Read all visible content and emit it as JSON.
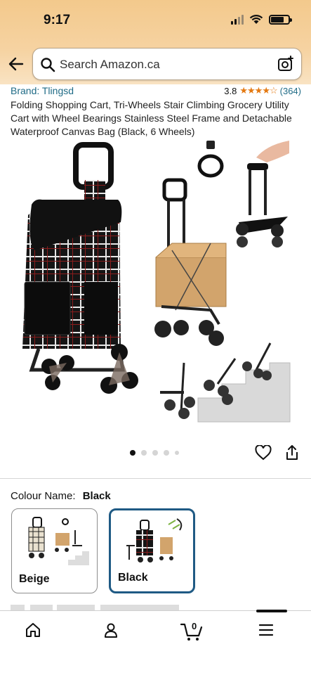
{
  "status_bar": {
    "time": "9:17"
  },
  "search": {
    "placeholder": "Search Amazon.ca"
  },
  "product": {
    "brand": "Brand: Tlingsd",
    "rating_value": "3.8",
    "rating_stars": "★★★★☆",
    "rating_count": "(364)",
    "title": "Folding Shopping Cart, Tri-Wheels Stair Climbing Grocery Utility Cart with Wheel Bearings Stainless Steel Frame and Detachable Waterproof Canvas Bag (Black, 6 Wheels)"
  },
  "gallery": {
    "image_count": 5,
    "active_index": 0
  },
  "colour": {
    "label": "Colour Name:",
    "selected": "Black",
    "options": [
      {
        "name": "Beige",
        "selected": false
      },
      {
        "name": "Black",
        "selected": true
      }
    ]
  },
  "cart": {
    "count": "0"
  },
  "icons": {
    "back": "back-arrow-icon",
    "search": "search-icon",
    "camera": "camera-search-icon",
    "heart": "heart-icon",
    "share": "share-icon",
    "home": "home-icon",
    "account": "account-icon",
    "cart": "cart-icon",
    "menu": "menu-icon"
  },
  "colors": {
    "link": "#1f6b86",
    "star": "#e47911",
    "selected_border": "#1f5a84"
  }
}
